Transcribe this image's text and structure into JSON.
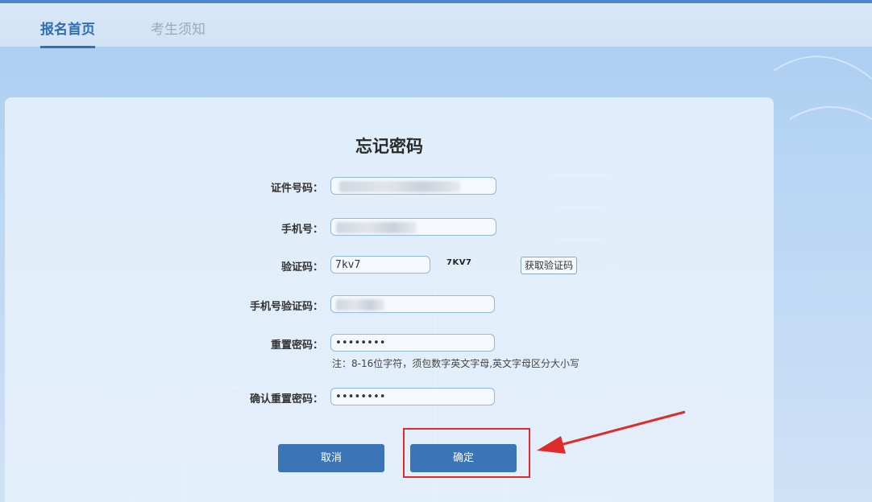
{
  "header": {
    "tabs": [
      {
        "label": "报名首页",
        "active": true
      },
      {
        "label": "考生须知",
        "active": false
      }
    ]
  },
  "form": {
    "title": "忘记密码",
    "fields": [
      {
        "label": "证件号码：",
        "value": ""
      },
      {
        "label": "手机号：",
        "value": ""
      },
      {
        "label": "验证码：",
        "value": "7kv7"
      },
      {
        "label": "手机号验证码：",
        "value": ""
      },
      {
        "label": "重置密码：",
        "value": "••••••••"
      },
      {
        "label": "确认重置密码：",
        "value": "••••••••"
      }
    ],
    "captcha_text": "7KV7",
    "get_code_button": "获取验证码",
    "password_hint": "注：8-16位字符，须包数字英文字母,英文字母区分大小写",
    "cancel_button": "取消",
    "confirm_button": "确定"
  },
  "colors": {
    "accent": "#2f6fb8",
    "button": "#3b75b8",
    "annotation": "#e02b2b"
  }
}
